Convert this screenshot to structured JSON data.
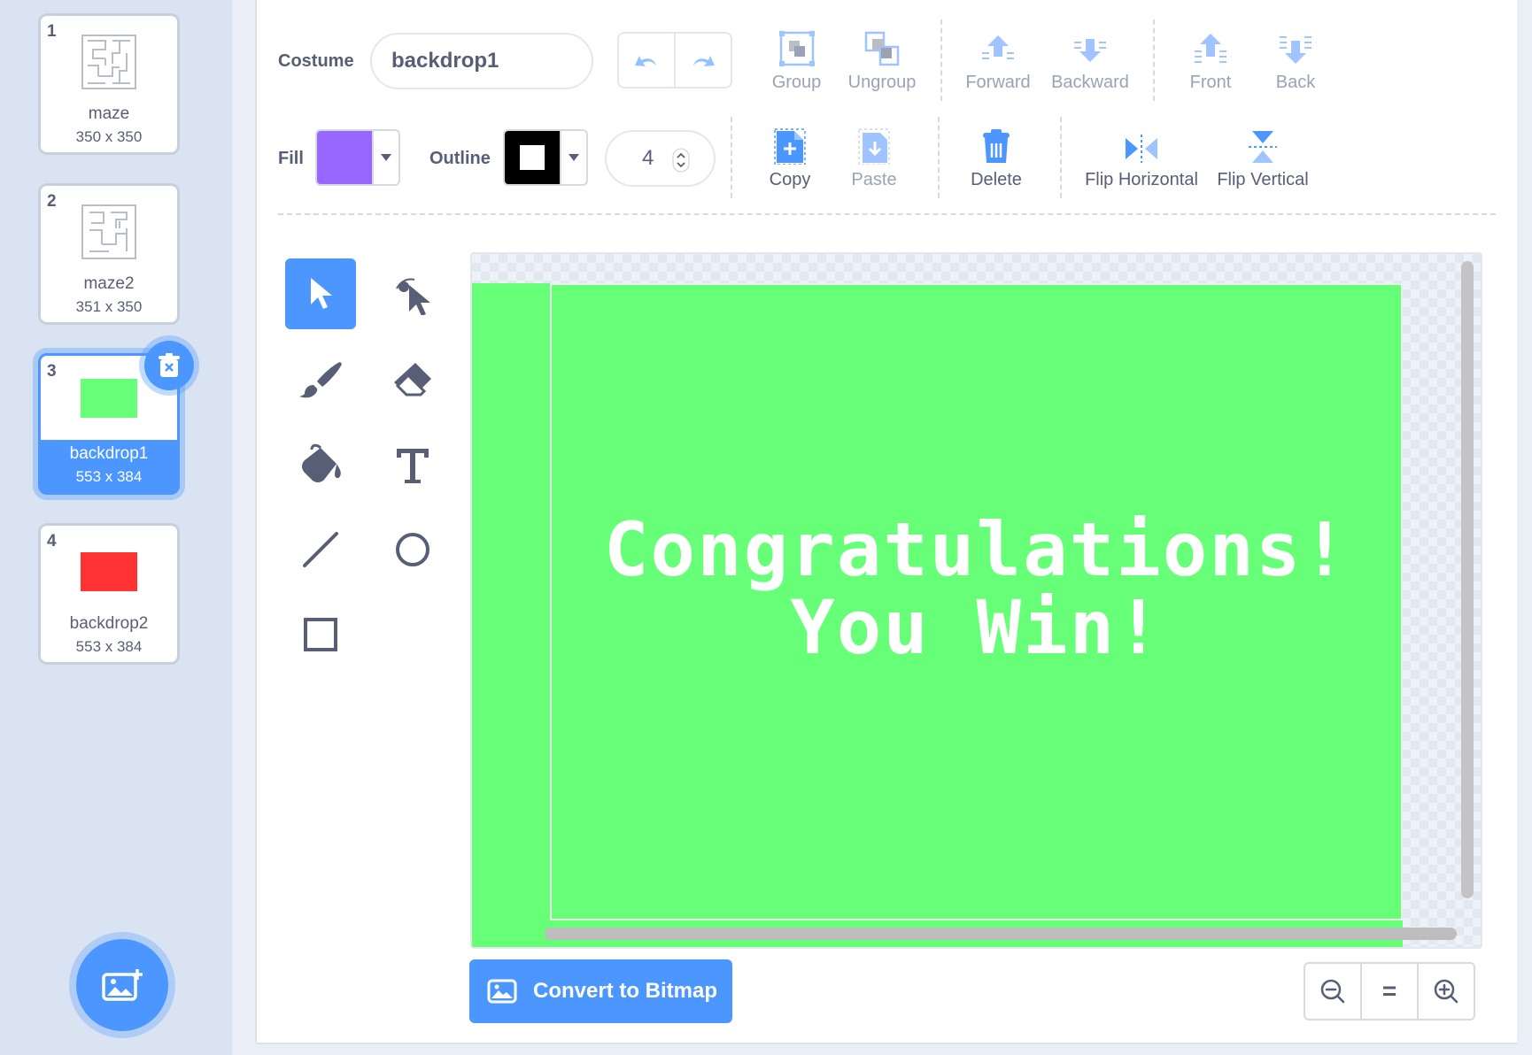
{
  "costumes": [
    {
      "num": "1",
      "name": "maze",
      "size": "350 x 350"
    },
    {
      "num": "2",
      "name": "maze2",
      "size": "351 x 350"
    },
    {
      "num": "3",
      "name": "backdrop1",
      "size": "553 x 384",
      "selected": true
    },
    {
      "num": "4",
      "name": "backdrop2",
      "size": "553 x 384"
    }
  ],
  "toolbar": {
    "costume_label": "Costume",
    "costume_name": "backdrop1",
    "group": "Group",
    "ungroup": "Ungroup",
    "forward": "Forward",
    "backward": "Backward",
    "front": "Front",
    "back": "Back",
    "fill_label": "Fill",
    "fill_color": "#9966ff",
    "outline_label": "Outline",
    "outline_color": "#000000",
    "outline_width": "4",
    "copy": "Copy",
    "paste": "Paste",
    "delete": "Delete",
    "flip_horizontal": "Flip Horizontal",
    "flip_vertical": "Flip Vertical"
  },
  "canvas": {
    "line1": "Congratulations!",
    "line2": "You Win!",
    "bg_color": "#66ff77"
  },
  "convert_button": "Convert to Bitmap",
  "zoom": {
    "equal": "="
  },
  "colors": {
    "accent": "#4c97ff",
    "text": "#575e75"
  }
}
